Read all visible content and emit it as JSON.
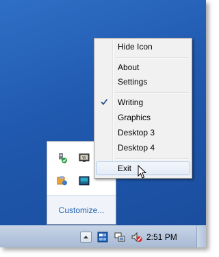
{
  "context_menu": {
    "items": [
      {
        "label": "Hide Icon",
        "checked": false
      },
      {
        "label": "About",
        "checked": false
      },
      {
        "label": "Settings",
        "checked": false
      },
      {
        "label": "Writing",
        "checked": true
      },
      {
        "label": "Graphics",
        "checked": false
      },
      {
        "label": "Desktop 3",
        "checked": false
      },
      {
        "label": "Desktop 4",
        "checked": false
      },
      {
        "label": "Exit",
        "checked": false,
        "hovered": true
      }
    ]
  },
  "flyout": {
    "icons": [
      "usb-safely-remove-icon",
      "monitor-app-icon",
      "network-share-icon",
      "display-icon"
    ],
    "customize_label": "Customize..."
  },
  "taskbar": {
    "tray_icons": [
      "show-hidden-icons-button",
      "virtual-desktop-icon",
      "network-icon",
      "volume-muted-icon"
    ],
    "clock": "2:51 PM"
  },
  "colors": {
    "desktop": "#1f58ad",
    "menu_bg": "#f1f1f1",
    "link": "#1c5fb0",
    "taskbar": "#b6c6dd"
  }
}
